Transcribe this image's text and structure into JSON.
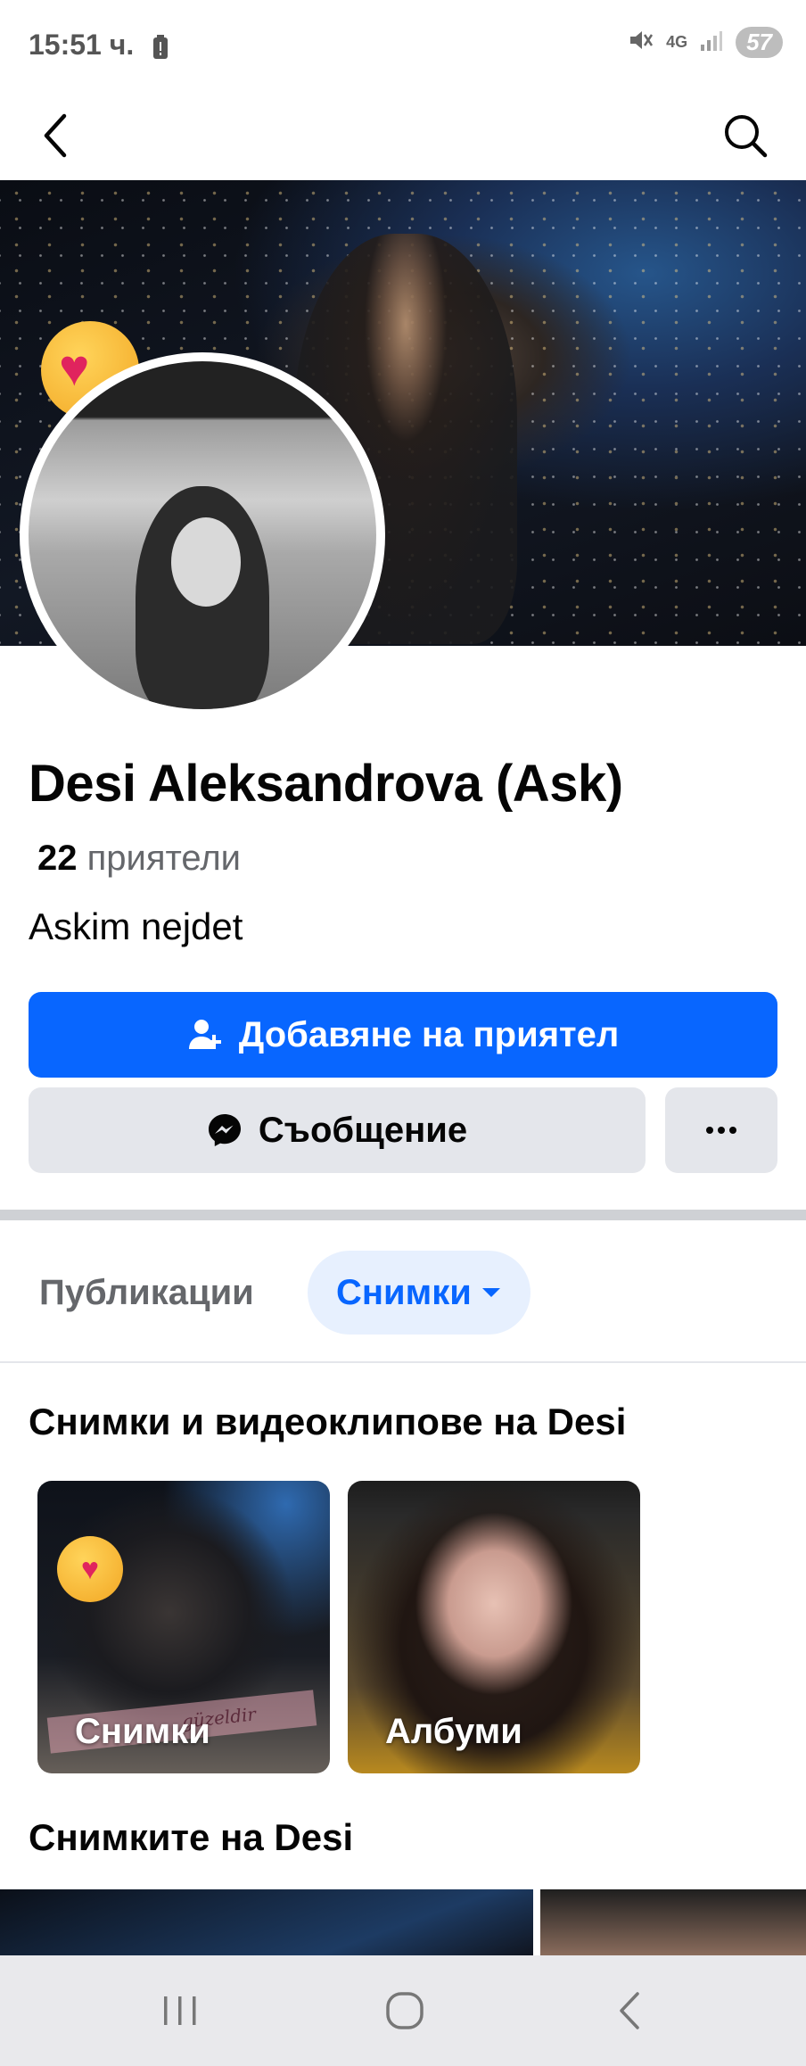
{
  "status_bar": {
    "time": "15:51 ч.",
    "network": "4G",
    "battery": "57"
  },
  "profile": {
    "name": "Desi Aleksandrova (Ask)",
    "friends_count": "22",
    "friends_label": "приятели",
    "bio": "Askim nejdet"
  },
  "actions": {
    "add_friend_label": "Добавяне на приятел",
    "message_label": "Съобщение"
  },
  "tabs": {
    "posts_label": "Публикации",
    "photos_label": "Снимки"
  },
  "photos_section": {
    "title": "Снимки и видеоклипове на Desi",
    "cards": {
      "photos_label": "Снимки",
      "albums_label": "Албуми"
    },
    "watermark_text": "güzeldir"
  },
  "desi_photos_section": {
    "title": "Снимките на Desi"
  },
  "colors": {
    "primary": "#0866ff",
    "secondary_bg": "#e4e6eb",
    "tab_active_bg": "#e7f0fe"
  }
}
